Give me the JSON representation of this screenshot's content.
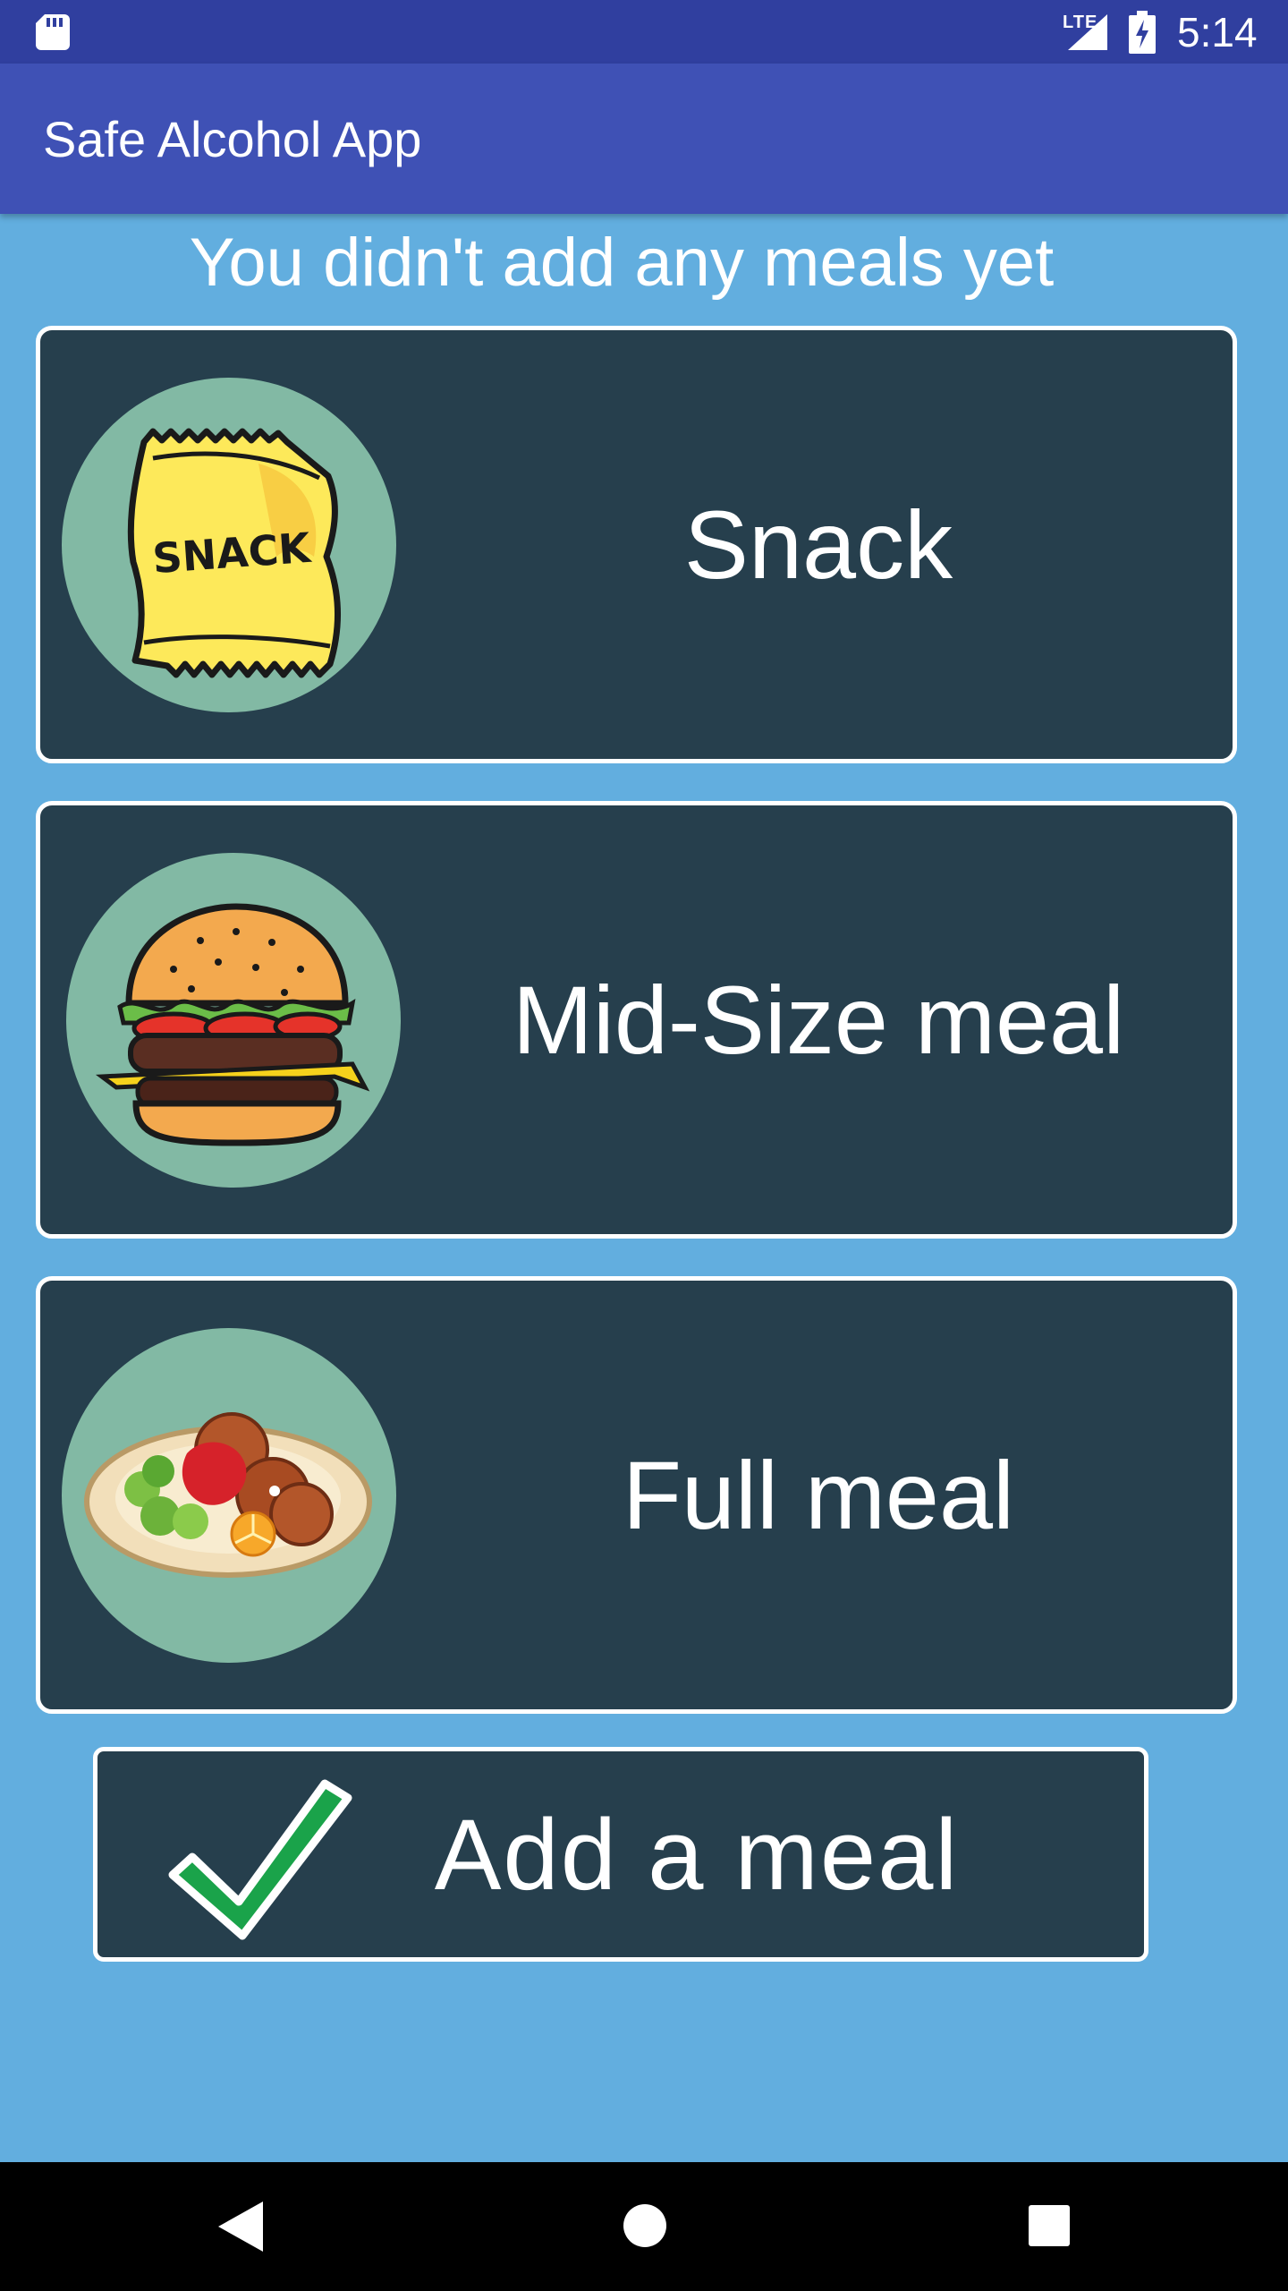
{
  "status_bar": {
    "network": "LTE",
    "time": "5:14"
  },
  "app_bar": {
    "title": "Safe Alcohol App"
  },
  "main": {
    "heading": "You didn't add any meals yet",
    "meal_options": [
      {
        "label": "Snack",
        "icon": "snack-bag-icon",
        "image_text": "SNACK"
      },
      {
        "label": "Mid-Size meal",
        "icon": "burger-icon"
      },
      {
        "label": "Full meal",
        "icon": "plate-meal-icon"
      }
    ],
    "add_button": {
      "label": "Add a meal",
      "icon": "checkmark-icon"
    }
  },
  "colors": {
    "background": "#62aedf",
    "app_bar": "#3f51b5",
    "status_bar": "#303f9f",
    "card": "#263f4d",
    "circle": "#82b9a4",
    "check": "#1aa34a"
  }
}
